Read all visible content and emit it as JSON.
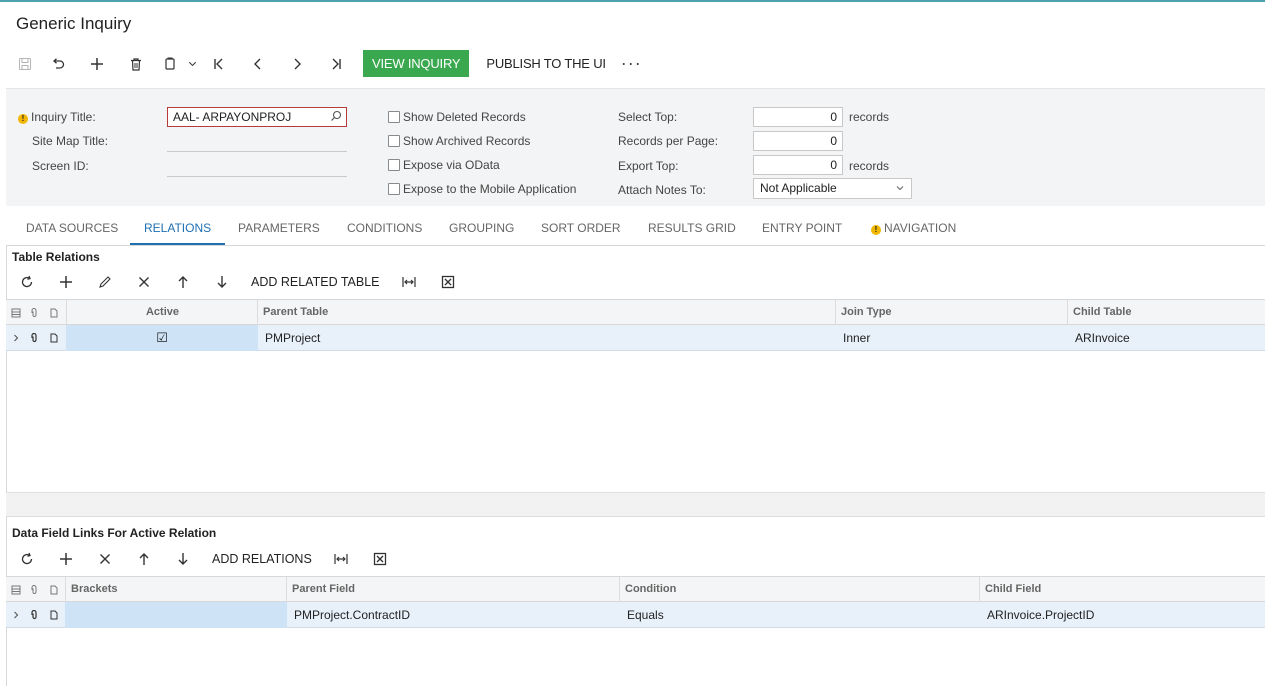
{
  "page_title": "Generic Inquiry",
  "toolbar": {
    "icons": [
      "save-icon",
      "undo-icon",
      "add-icon",
      "delete-icon",
      "copy-paste-icon",
      "first-icon",
      "prev-icon",
      "next-icon",
      "last-icon"
    ],
    "view_inquiry": "VIEW INQUIRY",
    "publish": "PUBLISH TO THE UI",
    "more": "···"
  },
  "form": {
    "inquiry_title_label": "Inquiry Title:",
    "inquiry_title_value": "AAL- ARPAYONPROJ",
    "site_map_title_label": "Site Map Title:",
    "screen_id_label": "Screen ID:",
    "show_deleted": "Show Deleted Records",
    "show_archived": "Show Archived Records",
    "expose_odata": "Expose via OData",
    "expose_mobile": "Expose to the Mobile Application",
    "select_top_label": "Select Top:",
    "select_top_value": "0",
    "records_per_page_label": "Records per Page:",
    "records_per_page_value": "0",
    "export_top_label": "Export Top:",
    "export_top_value": "0",
    "records_suffix": "records",
    "attach_notes_label": "Attach Notes To:",
    "attach_notes_value": "Not Applicable"
  },
  "tabs": [
    {
      "label": "DATA SOURCES"
    },
    {
      "label": "RELATIONS"
    },
    {
      "label": "PARAMETERS"
    },
    {
      "label": "CONDITIONS"
    },
    {
      "label": "GROUPING"
    },
    {
      "label": "SORT ORDER"
    },
    {
      "label": "RESULTS GRID"
    },
    {
      "label": "ENTRY POINT"
    },
    {
      "label": "NAVIGATION"
    }
  ],
  "active_tab": "RELATIONS",
  "table_relations": {
    "title": "Table Relations",
    "add_button": "ADD RELATED TABLE",
    "columns": [
      "Active",
      "Parent Table",
      "Join Type",
      "Child Table"
    ],
    "rows": [
      {
        "active": "☑",
        "parent_table": "PMProject",
        "join_type": "Inner",
        "child_table": "ARInvoice"
      }
    ]
  },
  "data_field_links": {
    "title": "Data Field Links For Active Relation",
    "add_button": "ADD RELATIONS",
    "columns": [
      "Brackets",
      "Parent Field",
      "Condition",
      "Child Field"
    ],
    "rows": [
      {
        "brackets": "",
        "parent_field": "PMProject.ContractID",
        "condition": "Equals",
        "child_field": "ARInvoice.ProjectID"
      }
    ]
  }
}
